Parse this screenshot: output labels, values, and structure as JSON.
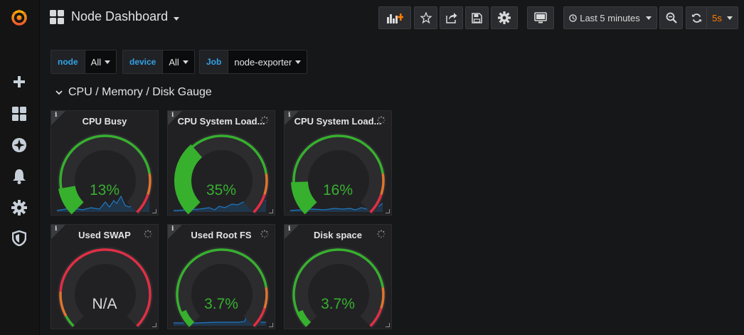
{
  "dashboard": {
    "title": "Node Dashboard"
  },
  "sidebar": {
    "items": [
      {
        "name": "create-icon"
      },
      {
        "name": "dashboards-icon"
      },
      {
        "name": "explore-icon"
      },
      {
        "name": "alerting-icon"
      },
      {
        "name": "configuration-icon"
      },
      {
        "name": "server-admin-icon"
      }
    ]
  },
  "toolbar": {
    "time_range": "Last 5 minutes",
    "refresh_interval": "5s"
  },
  "variables": [
    {
      "label": "node",
      "value": "All"
    },
    {
      "label": "device",
      "value": "All"
    },
    {
      "label": "Job",
      "value": "node-exporter"
    }
  ],
  "row": {
    "title": "CPU / Memory / Disk Gauge"
  },
  "panels": [
    {
      "title": "CPU Busy",
      "value": "13%",
      "fraction": 0.13,
      "thresholds": "green",
      "color": "#37b02e",
      "sparkline": true,
      "loading": false
    },
    {
      "title": "CPU System Load...",
      "value": "35%",
      "fraction": 0.35,
      "thresholds": "green",
      "color": "#37b02e",
      "sparkline": true,
      "loading": true
    },
    {
      "title": "CPU System Load...",
      "value": "16%",
      "fraction": 0.16,
      "thresholds": "green",
      "color": "#37b02e",
      "sparkline": true,
      "loading": true
    },
    {
      "title": "Used SWAP",
      "value": "N/A",
      "fraction": 0,
      "thresholds": "red",
      "color": "#d8d9da",
      "sparkline": false,
      "loading": true
    },
    {
      "title": "Used Root FS",
      "value": "3.7%",
      "fraction": 0.037,
      "thresholds": "green",
      "color": "#37b02e",
      "sparkline": true,
      "loading": true
    },
    {
      "title": "Disk space",
      "value": "3.7%",
      "fraction": 0.037,
      "thresholds": "green",
      "color": "#37b02e",
      "sparkline": false,
      "loading": true
    }
  ],
  "colors": {
    "ok": "#37b02e",
    "warn": "#e0752d",
    "critical": "#e02f44",
    "accent": "#ff7d00",
    "sparkline": "#1f78c1"
  }
}
